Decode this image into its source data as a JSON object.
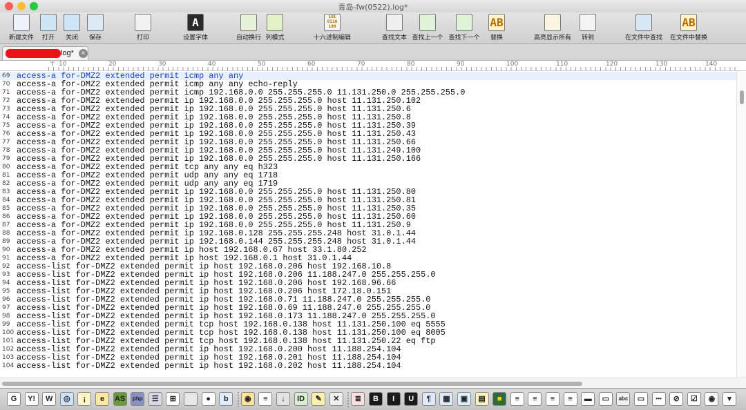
{
  "window": {
    "title": "青岛-fw(0522).log*",
    "traffic_lights": [
      "#fc5f57",
      "#fdbc2e",
      "#28c840"
    ]
  },
  "toolbar": {
    "buttons": [
      {
        "label": "新建文件",
        "icon": "new-file-icon"
      },
      {
        "label": "打开",
        "icon": "open-folder-icon"
      },
      {
        "label": "关闭",
        "icon": "close-folder-icon"
      },
      {
        "label": "保存",
        "icon": "save-icon"
      },
      {
        "label": "打印",
        "icon": "print-icon"
      },
      {
        "label": "设置字体",
        "icon": "font-icon",
        "glyph": "A"
      },
      {
        "label": "自动换行",
        "icon": "word-wrap-icon"
      },
      {
        "label": "列模式",
        "icon": "column-mode-icon"
      },
      {
        "label": "十六进制编辑",
        "icon": "hex-edit-icon",
        "glyph": "101\n0110\n100"
      },
      {
        "label": "查找文本",
        "icon": "binoculars-icon"
      },
      {
        "label": "查找上一个",
        "icon": "find-previous-icon"
      },
      {
        "label": "查找下一个",
        "icon": "find-next-icon"
      },
      {
        "label": "替换",
        "icon": "replace-icon",
        "glyph": "AB"
      },
      {
        "label": "高亮显示所有",
        "icon": "highlight-all-icon"
      },
      {
        "label": "转到",
        "icon": "goto-icon"
      },
      {
        "label": "在文件中查找",
        "icon": "find-in-files-icon"
      },
      {
        "label": "在文件中替换",
        "icon": "replace-in-files-icon",
        "glyph": "AB"
      }
    ]
  },
  "tab": {
    "label": "log*",
    "close_glyph": "×"
  },
  "ruler": {
    "marks": [
      "10",
      "20",
      "30",
      "40",
      "50",
      "60",
      "70",
      "80",
      "90",
      "100",
      "110",
      "120",
      "130",
      "140"
    ]
  },
  "editor": {
    "current_line": 69,
    "lines": [
      {
        "n": "69",
        "text": "access-a for-DMZ2 extended permit icmp any any"
      },
      {
        "n": "70",
        "text": "access-a for-DMZ2 extended permit icmp any any echo-reply"
      },
      {
        "n": "71",
        "text": "access-a for-DMZ2 extended permit icmp 192.168.0.0 255.255.255.0 11.131.250.0 255.255.255.0"
      },
      {
        "n": "72",
        "text": "access-a for-DMZ2 extended permit ip 192.168.0.0 255.255.255.0 host 11.131.250.102"
      },
      {
        "n": "73",
        "text": "access-a for-DMZ2 extended permit ip 192.168.0.0 255.255.255.0 host 11.131.250.6"
      },
      {
        "n": "74",
        "text": "access-a for-DMZ2 extended permit ip 192.168.0.0 255.255.255.0 host 11.131.250.8"
      },
      {
        "n": "75",
        "text": "access-a for-DMZ2 extended permit ip 192.168.0.0 255.255.255.0 host 11.131.250.39"
      },
      {
        "n": "76",
        "text": "access-a for-DMZ2 extended permit ip 192.168.0.0 255.255.255.0 host 11.131.250.43"
      },
      {
        "n": "77",
        "text": "access-a for-DMZ2 extended permit ip 192.168.0.0 255.255.255.0 host 11.131.250.66"
      },
      {
        "n": "78",
        "text": "access-a for-DMZ2 extended permit ip 192.168.0.0 255.255.255.0 host 11.131.249.100"
      },
      {
        "n": "79",
        "text": "access-a for-DMZ2 extended permit ip 192.168.0.0 255.255.255.0 host 11.131.250.166"
      },
      {
        "n": "80",
        "text": "access-a for-DMZ2 extended permit tcp any any eq h323"
      },
      {
        "n": "81",
        "text": "access-a for-DMZ2 extended permit udp any any eq 1718"
      },
      {
        "n": "82",
        "text": "access-a for-DMZ2 extended permit udp any any eq 1719"
      },
      {
        "n": "83",
        "text": "access-a for-DMZ2 extended permit ip 192.168.0.0 255.255.255.0 host 11.131.250.80"
      },
      {
        "n": "84",
        "text": "access-a for-DMZ2 extended permit ip 192.168.0.0 255.255.255.0 host 11.131.250.81"
      },
      {
        "n": "85",
        "text": "access-a for-DMZ2 extended permit ip 192.168.0.0 255.255.255.0 host 11.131.250.35"
      },
      {
        "n": "86",
        "text": "access-a for-DMZ2 extended permit ip 192.168.0.0 255.255.255.0 host 11.131.250.60"
      },
      {
        "n": "87",
        "text": "access-a for-DMZ2 extended permit ip 192.168.0.0 255.255.255.0 host 11.131.250.9"
      },
      {
        "n": "88",
        "text": "access-a for-DMZ2 extended permit ip 192.168.0.128 255.255.255.248 host 31.0.1.44"
      },
      {
        "n": "89",
        "text": "access-a for-DMZ2 extended permit ip 192.168.0.144 255.255.255.248 host 31.0.1.44"
      },
      {
        "n": "90",
        "text": "access-a for-DMZ2 extended permit ip host 192.168.0.67 host 33.1.80.252"
      },
      {
        "n": "91",
        "text": "access-a for-DMZ2 extended permit ip host 192.168.0.1 host 31.0.1.44"
      },
      {
        "n": "92",
        "text": "access-list for-DMZ2 extended permit ip host 192.168.0.206 host 192.168.10.8"
      },
      {
        "n": "93",
        "text": "access-list for-DMZ2 extended permit ip host 192.168.0.206 11.188.247.0 255.255.255.0"
      },
      {
        "n": "94",
        "text": "access-list for-DMZ2 extended permit ip host 192.168.0.206 host 192.168.96.66"
      },
      {
        "n": "95",
        "text": "access-list for-DMZ2 extended permit ip host 192.168.0.206 host 172.18.0.151"
      },
      {
        "n": "96",
        "text": "access-list for-DMZ2 extended permit ip host 192.168.0.71 11.188.247.0 255.255.255.0"
      },
      {
        "n": "97",
        "text": "access-list for-DMZ2 extended permit ip host 192.168.0.69 11.188.247.0 255.255.255.0"
      },
      {
        "n": "98",
        "text": "access-list for-DMZ2 extended permit ip host 192.168.0.173 11.188.247.0 255.255.255.0"
      },
      {
        "n": "99",
        "text": "access-list for-DMZ2 extended permit tcp host 192.168.0.138 host 11.131.250.100 eq 5555"
      },
      {
        "n": "100",
        "text": "access-list for-DMZ2 extended permit tcp host 192.168.0.138 host 11.131.250.100 eq 8005"
      },
      {
        "n": "101",
        "text": "access-list for-DMZ2 extended permit tcp host 192.168.0.138 host 11.131.250.22 eq ftp"
      },
      {
        "n": "102",
        "text": "access-list for-DMZ2 extended permit ip host 192.168.0.200 host 11.188.254.104"
      },
      {
        "n": "103",
        "text": "access-list for-DMZ2 extended permit ip host 192.168.0.201 host 11.188.254.104"
      },
      {
        "n": "104",
        "text": "access-list for-DMZ2 extended permit ip host 192.168.0.202 host 11.188.254.104"
      }
    ]
  },
  "bottom_bar": {
    "icons": [
      {
        "name": "google-icon",
        "glyph": "G",
        "bg": "#ffffff"
      },
      {
        "name": "yahoo-icon",
        "glyph": "Y!",
        "bg": "#ffffff"
      },
      {
        "name": "wikipedia-icon",
        "glyph": "W",
        "bg": "#ffffff"
      },
      {
        "name": "web-icon",
        "glyph": "◎",
        "bg": "#cfe3ff"
      },
      {
        "name": "tip-icon",
        "glyph": "¡",
        "bg": "#fff6c8"
      },
      {
        "name": "ie-icon",
        "glyph": "e",
        "bg": "#ffe8a0"
      },
      {
        "name": "asp-icon",
        "glyph": "AS",
        "bg": "#6b9a3d"
      },
      {
        "name": "php-icon",
        "glyph": "php",
        "bg": "#8a8fc8"
      },
      {
        "name": "perl-icon",
        "glyph": "☰",
        "bg": "#d8d8e8"
      },
      {
        "name": "windows-icon",
        "glyph": "⊞",
        "bg": "#ffffff"
      },
      {
        "name": "apple-icon",
        "glyph": "",
        "bg": "#e8e8e8"
      },
      {
        "name": "apple-dark-icon",
        "glyph": "●",
        "bg": "#ffffff"
      },
      {
        "name": "bing-icon",
        "glyph": "b",
        "bg": "#e0ecff"
      },
      {
        "name": "chrome-icon",
        "glyph": "◉",
        "bg": "#ffe39a"
      },
      {
        "name": "document-icon",
        "glyph": "≡",
        "bg": "#ffffff"
      },
      {
        "name": "download-icon",
        "glyph": "↓",
        "bg": "#e4e4e4"
      },
      {
        "name": "id-icon",
        "glyph": "ID",
        "bg": "#d8f0d0"
      },
      {
        "name": "magic-wand-icon",
        "glyph": "✎",
        "bg": "#fff0b0"
      },
      {
        "name": "xml-icon",
        "glyph": "✕",
        "bg": "#f0f0f0"
      },
      {
        "name": "list-icon",
        "glyph": "≣",
        "bg": "#ffe0e0"
      },
      {
        "name": "bold-icon",
        "glyph": "B",
        "bg": "#1a1a1a",
        "fg": "#ffffff"
      },
      {
        "name": "italic-icon",
        "glyph": "I",
        "bg": "#1a1a1a",
        "fg": "#ffffff"
      },
      {
        "name": "underline-icon",
        "glyph": "U",
        "bg": "#1a1a1a",
        "fg": "#ffffff"
      },
      {
        "name": "paragraph-icon",
        "glyph": "¶",
        "bg": "#e0eaff"
      },
      {
        "name": "table-icon",
        "glyph": "▦",
        "bg": "#e0eaff"
      },
      {
        "name": "image-icon",
        "glyph": "▣",
        "bg": "#dff0ff"
      },
      {
        "name": "form-icon",
        "glyph": "▤",
        "bg": "#fff3c0"
      },
      {
        "name": "color-icon",
        "glyph": "■",
        "bg": "#2e6b3a",
        "fg": "#ffcf00"
      },
      {
        "name": "align-left-icon",
        "glyph": "≡",
        "bg": "#ffffff"
      },
      {
        "name": "align-center-icon",
        "glyph": "≡",
        "bg": "#ffffff"
      },
      {
        "name": "align-right-icon",
        "glyph": "≡",
        "bg": "#ffffff"
      },
      {
        "name": "justify-icon",
        "glyph": "≡",
        "bg": "#ffffff"
      },
      {
        "name": "block-icon",
        "glyph": "▬",
        "bg": "#ffffff"
      },
      {
        "name": "page-icon",
        "glyph": "▭",
        "bg": "#ffffff"
      },
      {
        "name": "abc-icon",
        "glyph": "abc",
        "bg": "#f0f0f0"
      },
      {
        "name": "field-icon",
        "glyph": "▭",
        "bg": "#ffffff"
      },
      {
        "name": "password-icon",
        "glyph": "•••",
        "bg": "#ffffff"
      },
      {
        "name": "no-icon",
        "glyph": "⊘",
        "bg": "#ffffff"
      },
      {
        "name": "checkbox-icon",
        "glyph": "☑",
        "bg": "#ffffff"
      },
      {
        "name": "radio-icon",
        "glyph": "◉",
        "bg": "#ffffff"
      },
      {
        "name": "select-icon",
        "glyph": "▾",
        "bg": "#ffffff"
      }
    ]
  }
}
